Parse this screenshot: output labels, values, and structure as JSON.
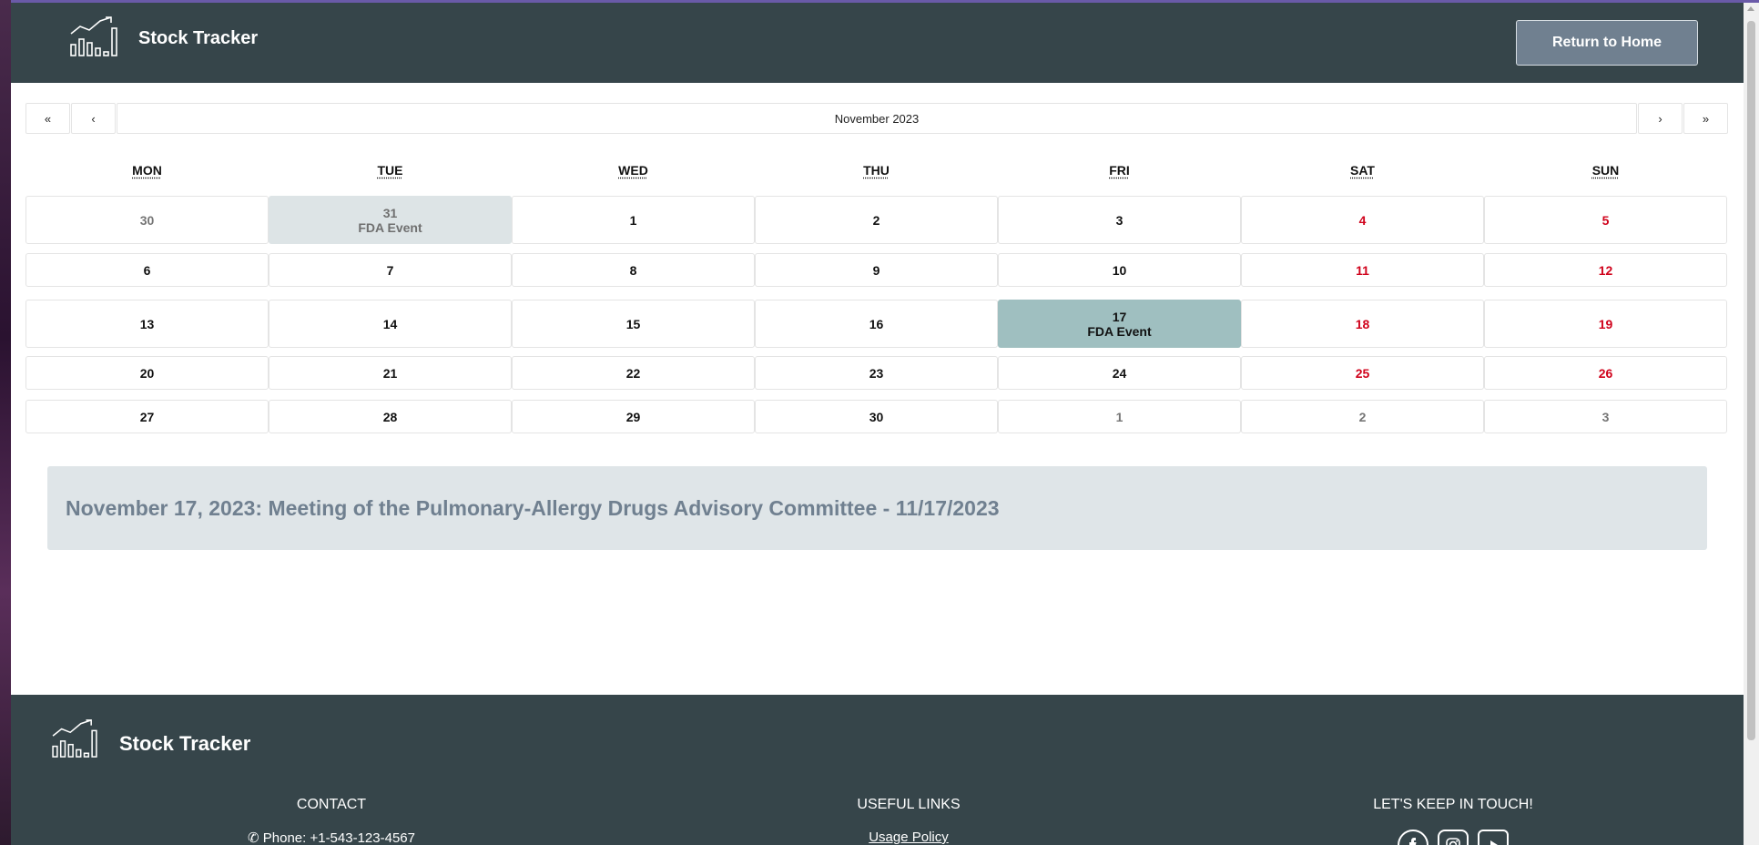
{
  "header": {
    "brand": "Stock Tracker",
    "home_button": "Return to Home"
  },
  "calendar": {
    "nav": {
      "prev_year": "«",
      "prev_month": "‹",
      "label": "November 2023",
      "next_month": "›",
      "next_year": "»"
    },
    "weekdays": [
      "MON",
      "TUE",
      "WED",
      "THU",
      "FRI",
      "SAT",
      "SUN"
    ],
    "weeks": [
      [
        {
          "day": "30",
          "kind": "neighbor"
        },
        {
          "day": "31",
          "kind": "neighbor-event",
          "event": "FDA Event"
        },
        {
          "day": "1",
          "kind": "normal"
        },
        {
          "day": "2",
          "kind": "normal"
        },
        {
          "day": "3",
          "kind": "normal"
        },
        {
          "day": "4",
          "kind": "weekend"
        },
        {
          "day": "5",
          "kind": "weekend"
        }
      ],
      [
        {
          "day": "6",
          "kind": "normal"
        },
        {
          "day": "7",
          "kind": "normal"
        },
        {
          "day": "8",
          "kind": "normal"
        },
        {
          "day": "9",
          "kind": "normal"
        },
        {
          "day": "10",
          "kind": "normal"
        },
        {
          "day": "11",
          "kind": "weekend"
        },
        {
          "day": "12",
          "kind": "weekend"
        }
      ],
      [
        {
          "day": "13",
          "kind": "normal"
        },
        {
          "day": "14",
          "kind": "normal"
        },
        {
          "day": "15",
          "kind": "normal"
        },
        {
          "day": "16",
          "kind": "normal"
        },
        {
          "day": "17",
          "kind": "active-event",
          "event": "FDA Event"
        },
        {
          "day": "18",
          "kind": "weekend"
        },
        {
          "day": "19",
          "kind": "weekend"
        }
      ],
      [
        {
          "day": "20",
          "kind": "normal"
        },
        {
          "day": "21",
          "kind": "normal"
        },
        {
          "day": "22",
          "kind": "normal"
        },
        {
          "day": "23",
          "kind": "normal"
        },
        {
          "day": "24",
          "kind": "normal"
        },
        {
          "day": "25",
          "kind": "weekend"
        },
        {
          "day": "26",
          "kind": "weekend"
        }
      ],
      [
        {
          "day": "27",
          "kind": "normal"
        },
        {
          "day": "28",
          "kind": "normal"
        },
        {
          "day": "29",
          "kind": "normal"
        },
        {
          "day": "30",
          "kind": "normal"
        },
        {
          "day": "1",
          "kind": "neighbor"
        },
        {
          "day": "2",
          "kind": "neighbor"
        },
        {
          "day": "3",
          "kind": "neighbor"
        }
      ]
    ]
  },
  "event_banner": {
    "text": "November 17, 2023: Meeting of the Pulmonary-Allergy Drugs Advisory Committee - 11/17/2023"
  },
  "footer": {
    "brand": "Stock Tracker",
    "contact_heading": "CONTACT",
    "contact_phone": "✆ Phone: +1-543-123-4567",
    "links_heading": "USEFUL LINKS",
    "links_first": "Usage Policy",
    "social_heading": "LET'S KEEP IN TOUCH!",
    "social_icons": [
      "facebook-icon",
      "instagram-icon",
      "youtube-icon"
    ]
  },
  "colors": {
    "header_bg": "#36454a",
    "accent_button": "#708090",
    "weekend_text": "#d0021b",
    "active_event": "#9fbfc0",
    "banner_bg": "#dfe5e8"
  }
}
